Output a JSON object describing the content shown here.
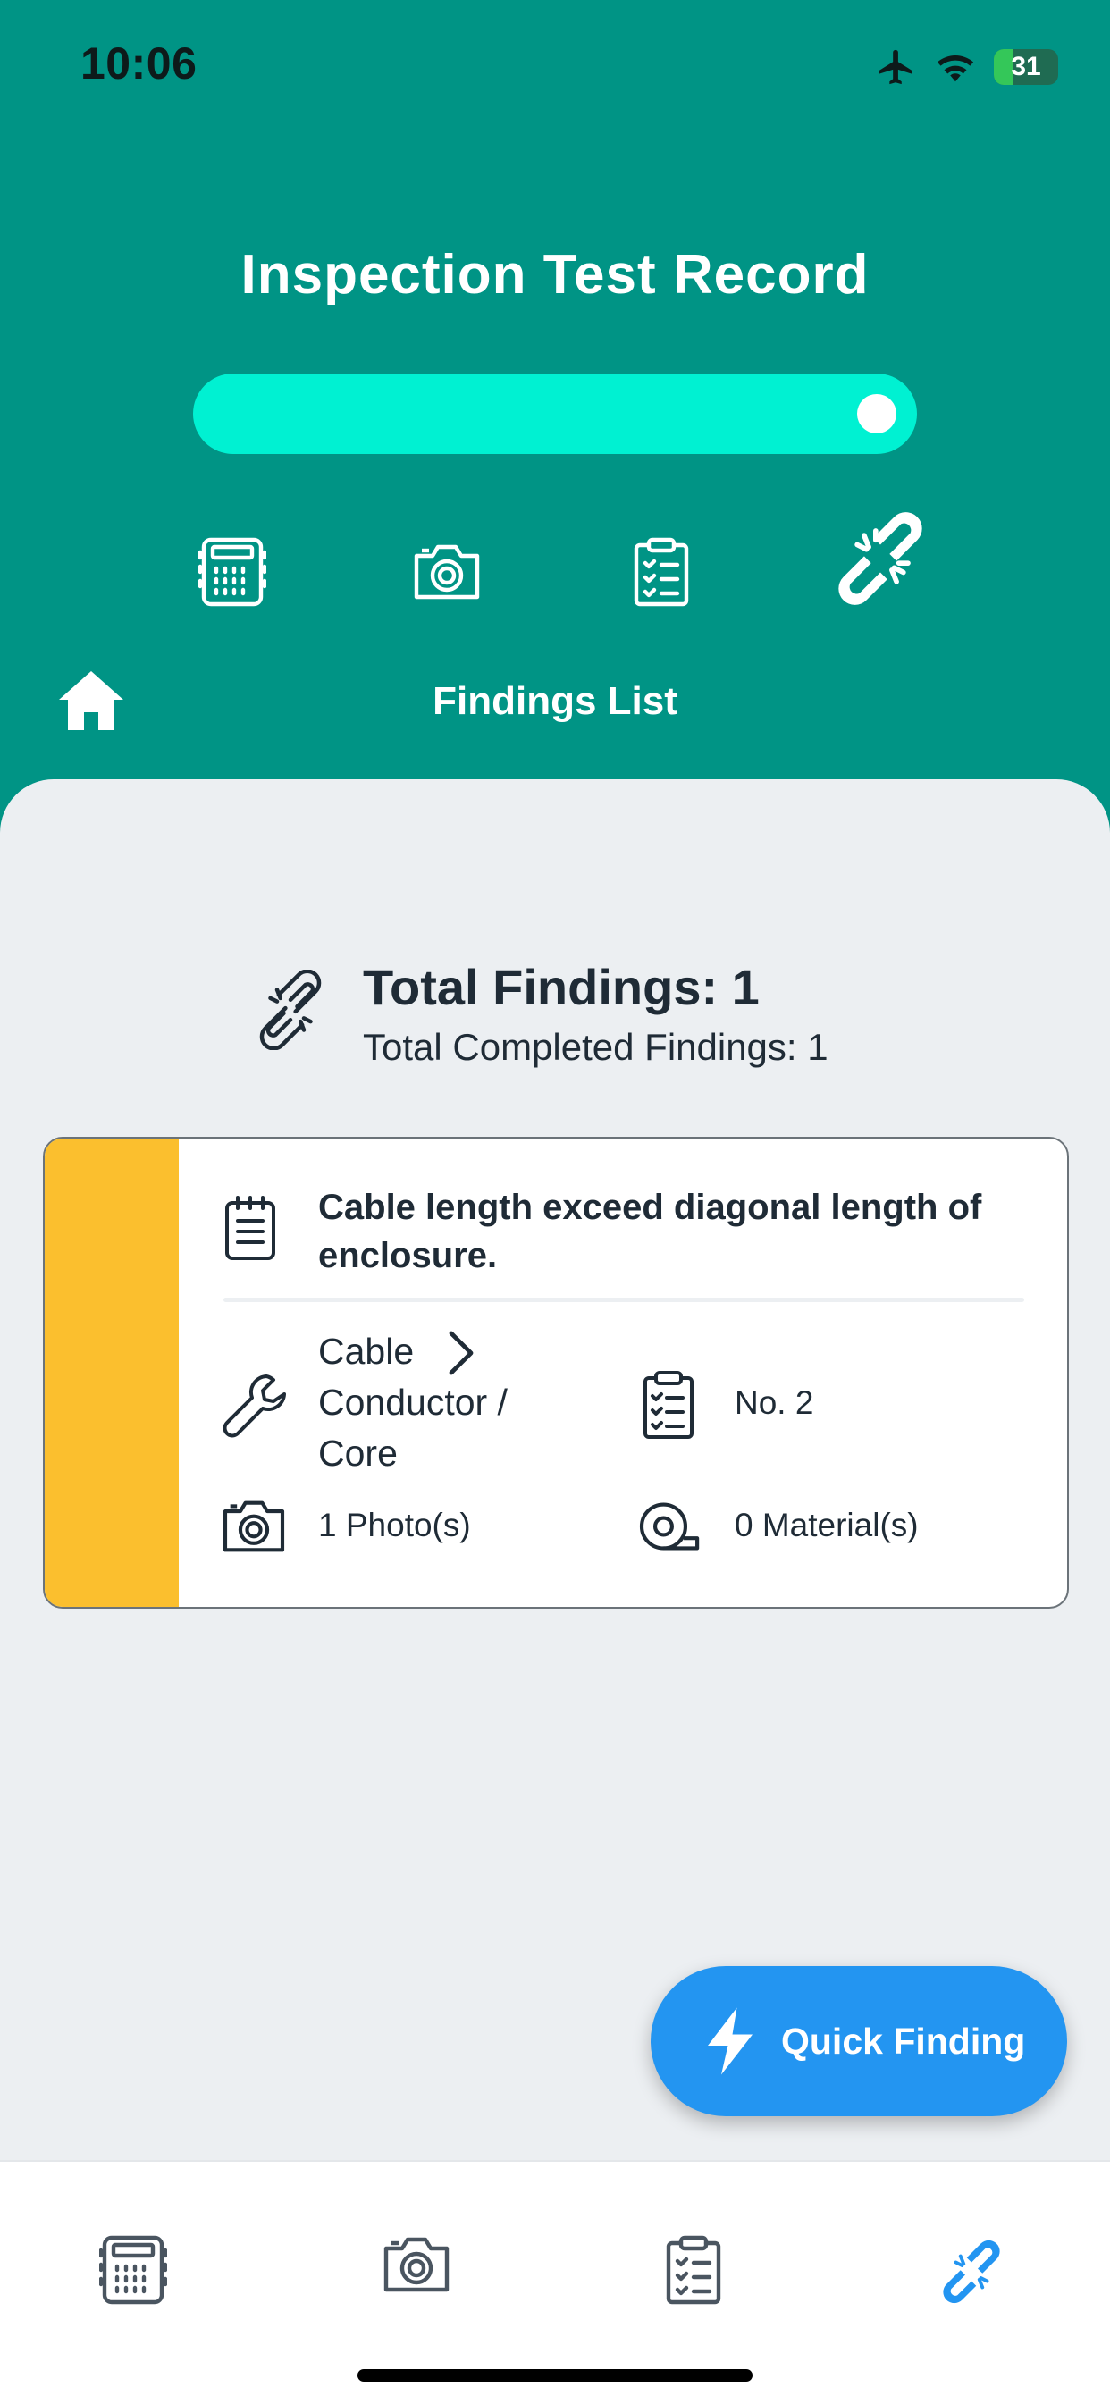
{
  "status_bar": {
    "time": "10:06",
    "battery": "31",
    "battery_level": 0.31
  },
  "header": {
    "title": "Inspection Test Record",
    "progress": 1.0
  },
  "steps": [
    {
      "icon": "calculator-icon",
      "active": false
    },
    {
      "icon": "camera-icon",
      "active": false
    },
    {
      "icon": "clipboard-checklist-icon",
      "active": false
    },
    {
      "icon": "broken-link-icon",
      "active": true
    }
  ],
  "nav": {
    "home_icon": "home-icon",
    "subtitle": "Findings List"
  },
  "summary": {
    "total_findings": "Total Findings: 1",
    "total_completed": "Total Completed Findings: 1"
  },
  "findings": [
    {
      "status_color": "#fbbf2e",
      "description": "Cable length exceed diagonal length of enclosure.",
      "component_lines": [
        "Cable",
        "Conductor /",
        "Core"
      ],
      "number": "No. 2",
      "photos": "1 Photo(s)",
      "materials": "0 Material(s)"
    }
  ],
  "fab": {
    "label": "Quick Finding"
  },
  "tabbar": [
    {
      "icon": "calculator-icon",
      "active": false
    },
    {
      "icon": "camera-icon",
      "active": false
    },
    {
      "icon": "clipboard-checklist-icon",
      "active": false
    },
    {
      "icon": "broken-link-icon",
      "active": true
    }
  ],
  "colors": {
    "brand": "#009485",
    "accent": "#00f1d2",
    "fab": "#2395f1",
    "tab_active": "#2395f1",
    "tab_inactive": "#4a5560"
  }
}
